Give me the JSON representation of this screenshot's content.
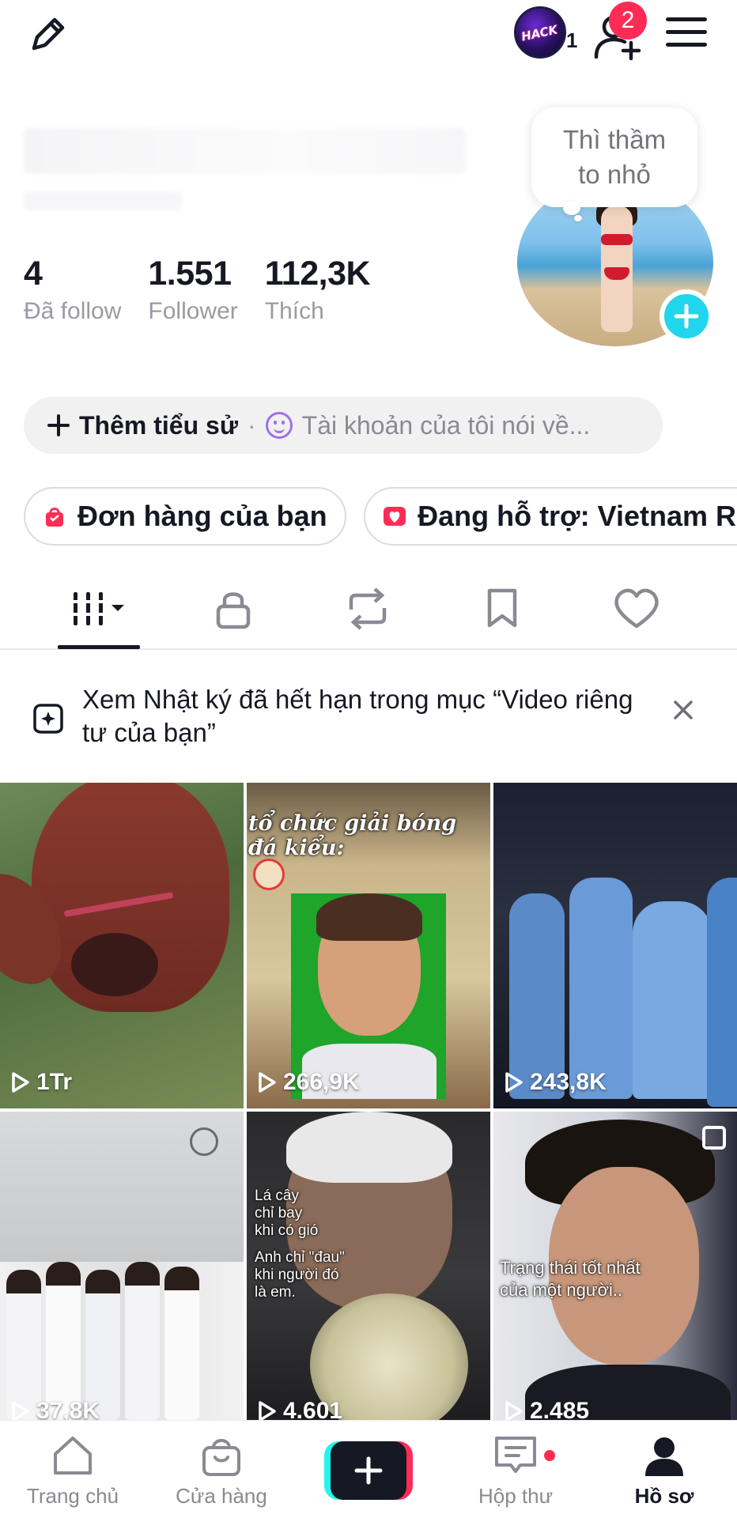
{
  "header": {
    "account_count": "1",
    "friend_requests_badge": "2"
  },
  "profile": {
    "bubble_text": "Thì thầm to nhỏ",
    "stats": [
      {
        "value": "4",
        "label": "Đã follow"
      },
      {
        "value": "1.551",
        "label": "Follower"
      },
      {
        "value": "112,3K",
        "label": "Thích"
      }
    ]
  },
  "bio": {
    "add_label": "Thêm tiểu sử",
    "separator": "·",
    "hint": "Tài khoản của tôi nói về..."
  },
  "chips": [
    {
      "label": "Đơn hàng của bạn",
      "icon": "shopping-bag-icon"
    },
    {
      "label": "Đang hỗ trợ: Vietnam Re",
      "icon": "heart-icon"
    }
  ],
  "tabs": [
    {
      "name": "videos-grid",
      "icon": "grid-bars-icon"
    },
    {
      "name": "private",
      "icon": "lock-icon"
    },
    {
      "name": "reposts",
      "icon": "repost-icon"
    },
    {
      "name": "favorites",
      "icon": "bookmark-icon"
    },
    {
      "name": "liked",
      "icon": "heart-icon"
    }
  ],
  "notice": {
    "text": "Xem Nhật ký đã hết hạn trong mục “Video riêng tư của bạn”"
  },
  "videos": [
    {
      "views": "1Tr",
      "overlay": ""
    },
    {
      "views": "266,9K",
      "overlay": "tổ chức giải bóng đá kiểu:"
    },
    {
      "views": "243,8K",
      "overlay": ""
    },
    {
      "views": "37,8K",
      "overlay": ""
    },
    {
      "views": "4.601",
      "overlay_lines": [
        "Lá cây",
        "chỉ bay",
        "khi có gió",
        "Anh chỉ \"đau\"",
        "khi người đó",
        "là em."
      ]
    },
    {
      "views": "2.485",
      "overlay_lines": [
        "Trạng thái tốt nhất",
        "của một người.."
      ]
    }
  ],
  "bottom_nav": [
    {
      "label": "Trang chủ",
      "icon": "home-icon"
    },
    {
      "label": "Cửa hàng",
      "icon": "shop-bag-icon"
    },
    {
      "label": "",
      "icon": "create-plus-icon"
    },
    {
      "label": "Hộp thư",
      "icon": "inbox-icon"
    },
    {
      "label": "Hồ sơ",
      "icon": "profile-icon"
    }
  ],
  "colors": {
    "accent_red": "#fe2c55",
    "accent_cyan": "#25f4ee",
    "plus_blue": "#20d5ec",
    "text_primary": "#161823",
    "text_secondary": "#8a8a93"
  }
}
